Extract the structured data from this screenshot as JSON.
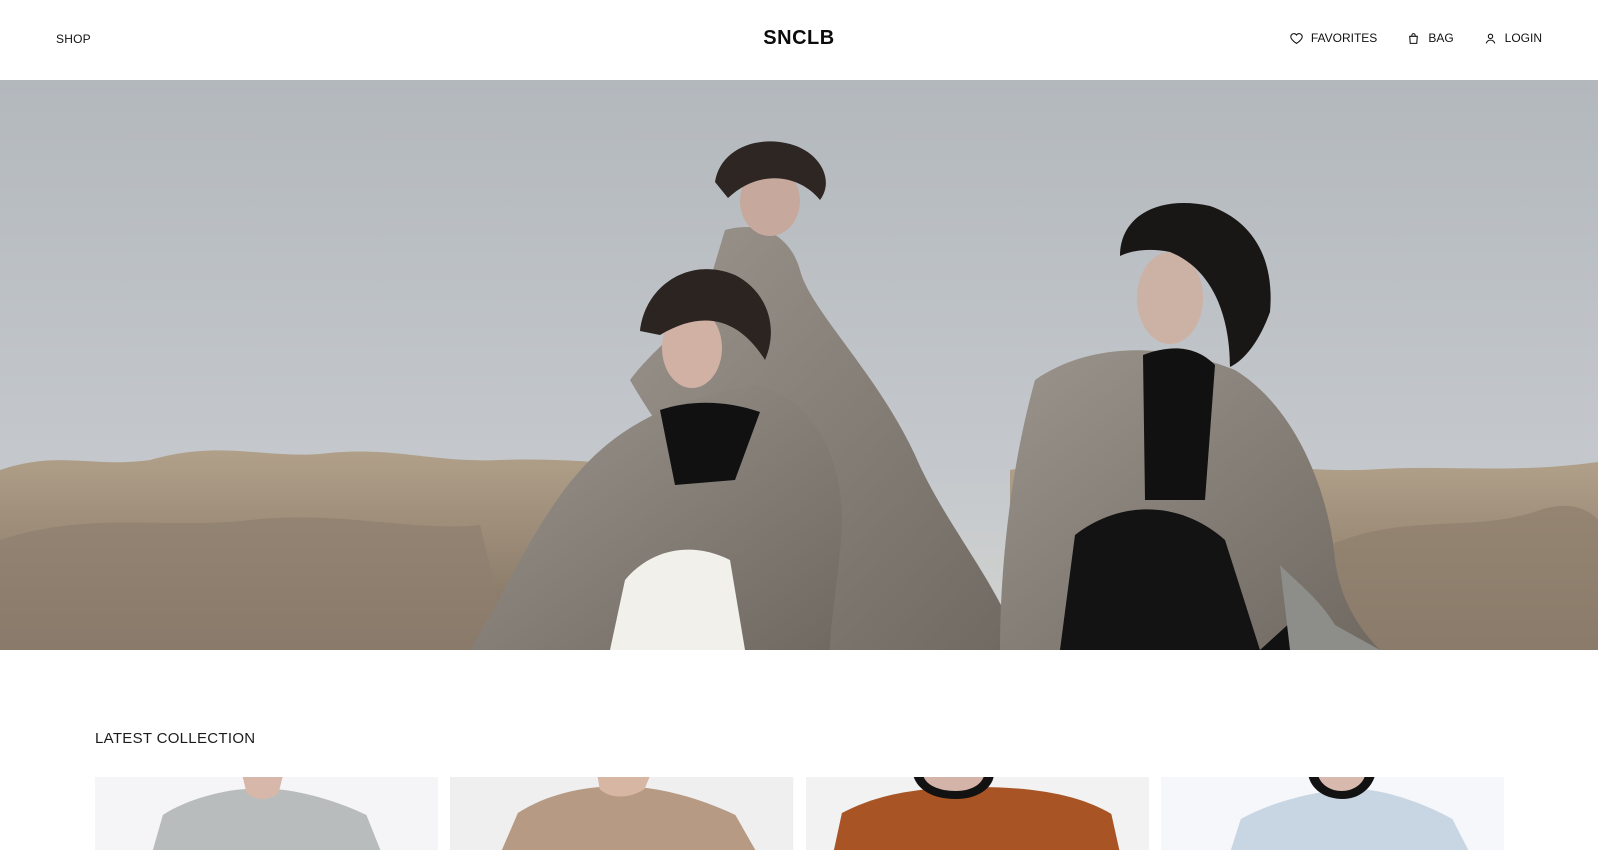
{
  "header": {
    "shop_label": "SHOP",
    "brand": "SNCLB",
    "favorites_label": "FAVORITES",
    "bag_label": "BAG",
    "login_label": "LOGIN"
  },
  "hero": {
    "image_semantic": "hero-fashion-image"
  },
  "latest_collection": {
    "title": "LATEST COLLECTION",
    "products": [
      {
        "name": "product-gray-tee",
        "color": "#b9bcbd"
      },
      {
        "name": "product-tan-tee",
        "color": "#b79a83"
      },
      {
        "name": "product-rust-tee",
        "color": "#a85425"
      },
      {
        "name": "product-light-blue-tee",
        "color": "#c8d6e3"
      }
    ]
  },
  "colors": {
    "sky": "#b9bdc2",
    "dune": "#9f8f7a",
    "coat": "#8c857b",
    "black": "#111111",
    "white": "#f3f3f1"
  }
}
